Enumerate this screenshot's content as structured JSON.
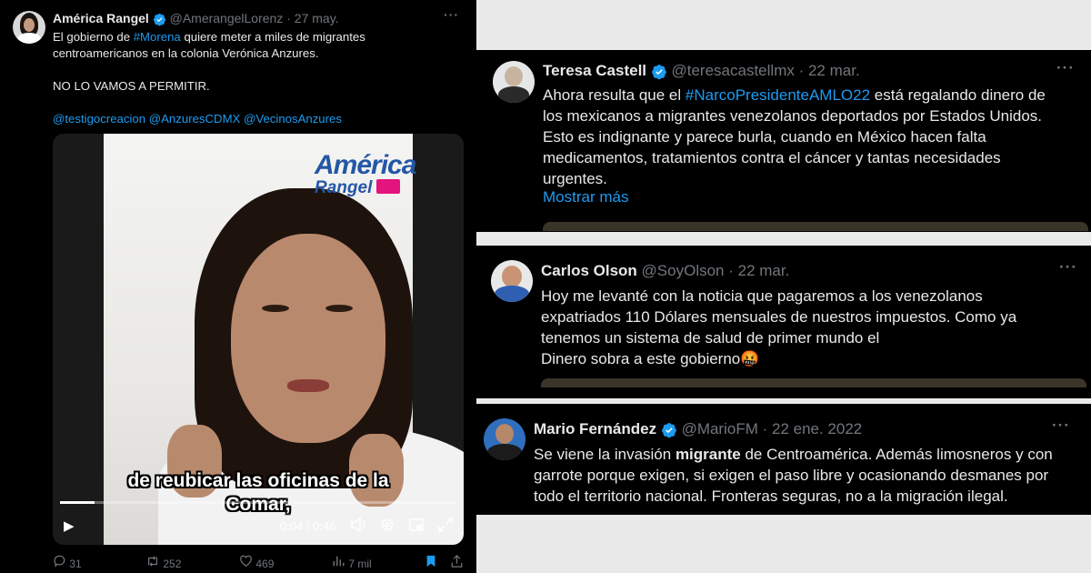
{
  "left_tweet": {
    "author": "América Rangel",
    "handle": "@AmerangelLorenz",
    "date": "· 27 may.",
    "text_before": "El gobierno de ",
    "hashtag": "#Morena",
    "text_after": " quiere meter a miles de migrantes centroamericanos en la colonia Verónica Anzures.",
    "text_line2": "NO LO VAMOS A PERMITIR.",
    "mentions": "@testigocreacion @AnzuresCDMX @VecinosAnzures",
    "video": {
      "logo_line1": "América",
      "logo_line2": "Rangel",
      "caption_line1": "de reubicar las oficinas de la",
      "caption_line2": "Comar,",
      "time": "0:04 / 0:46",
      "progress": 0.087
    },
    "actions": {
      "replies": "31",
      "reposts": "252",
      "likes": "469",
      "views": "7 mil"
    }
  },
  "tweets": [
    {
      "author": "Teresa Castell",
      "handle": "@teresacastellmx",
      "date": "· 22 mar.",
      "lines": [
        "Ahora resulta que el #NarcoPresidenteAMLO22 está regalando dinero de",
        "los mexicanos a migrantes venezolanos deportados por Estados Unidos.",
        "Esto es indignante y parece burla, cuando en México hacen falta",
        "medicamentos, tratamientos contra el cáncer y tantas necesidades",
        "urgentes."
      ],
      "hashtag": "#NarcoPresidenteAMLO22",
      "show_more": "Mostrar más"
    },
    {
      "author": "Carlos Olson",
      "handle": "@SoyOlson",
      "date": "· 22 mar.",
      "lines": [
        "Hoy me levanté con la noticia que pagaremos a los venezolanos",
        "expatriados 110 Dólares mensuales de nuestros impuestos. Como ya",
        "tenemos un sistema de salud de primer mundo el",
        "Dinero sobra a este gobierno"
      ],
      "emoji": "🤬"
    },
    {
      "author": "Mario Fernández",
      "handle": "@MarioFM",
      "date": "· 22 ene. 2022",
      "line1_before": "Se viene la invasión ",
      "line1_bold": "migrante",
      "line1_after": " de Centroamérica. Además limosneros y con",
      "line2": "garrote porque exigen, si exigen el paso libre y ocasionando desmanes por",
      "line3": "todo el territorio nacional. Fronteras seguras, no a la migración ilegal."
    }
  ],
  "icons": {
    "more": "···"
  },
  "colors": {
    "link": "#1d9bf0",
    "background": "#000000",
    "muted": "#71767b",
    "verified": "#1d9bf0"
  }
}
